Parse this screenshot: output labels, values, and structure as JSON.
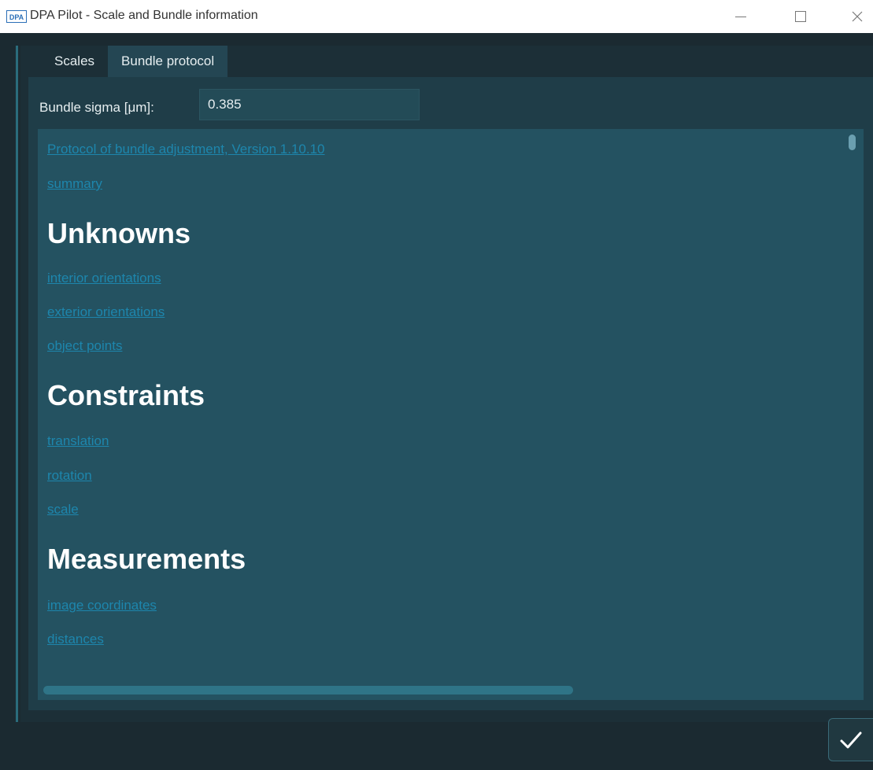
{
  "window": {
    "logo_text": "DPA",
    "title": "DPA Pilot - Scale and Bundle information"
  },
  "tabs": [
    {
      "label": "Scales",
      "active": false
    },
    {
      "label": "Bundle protocol",
      "active": true
    }
  ],
  "bundle_sigma": {
    "label": "Bundle sigma  [μm]:",
    "value": "0.385"
  },
  "protocol": {
    "header_link": "Protocol of bundle adjustment, Version 1.10.10",
    "summary_link": "summary",
    "sections": [
      {
        "heading": "Unknowns",
        "links": [
          "interior orientations",
          "exterior orientations",
          "object points"
        ]
      },
      {
        "heading": "Constraints",
        "links": [
          "translation",
          "rotation",
          "scale"
        ]
      },
      {
        "heading": "Measurements",
        "links": [
          "image coordinates",
          "distances"
        ]
      }
    ]
  },
  "colors": {
    "background": "#1b2a31",
    "tab_active": "#244653",
    "viewer_background": "#245261",
    "link": "#1d86ad",
    "heading": "#ffffff"
  },
  "icons": {
    "ok_button": "checkmark-icon"
  }
}
